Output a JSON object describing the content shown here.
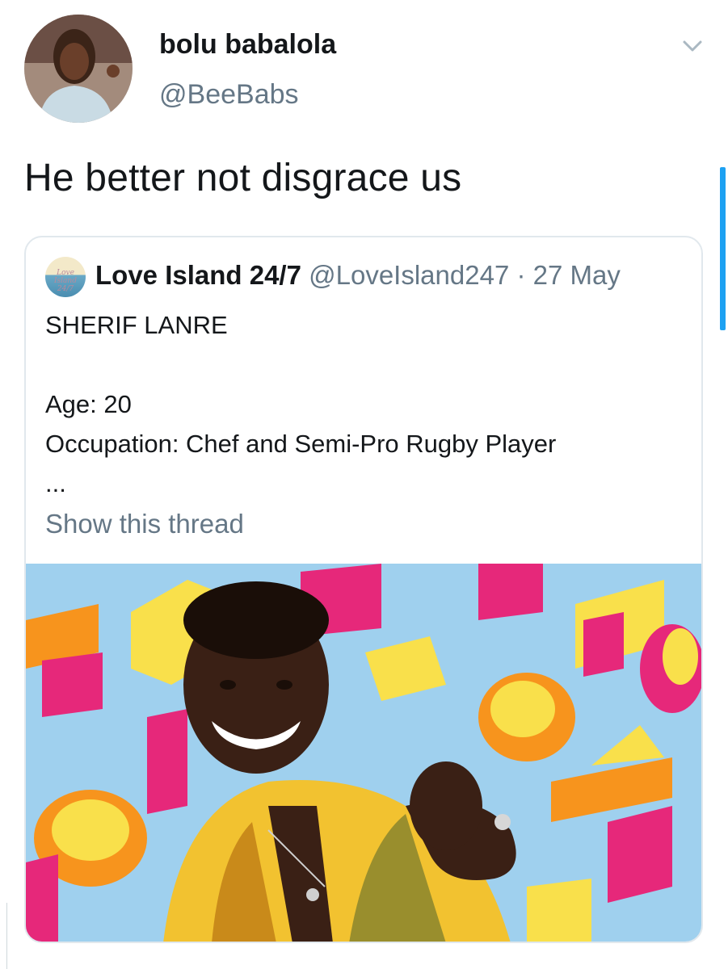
{
  "tweet": {
    "author": {
      "display_name": "bolu babalola",
      "handle": "@BeeBabs"
    },
    "text": "He better not disgrace us",
    "menu_icon": "chevron-down-icon"
  },
  "quoted_tweet": {
    "author": {
      "display_name": "Love Island 24/7",
      "handle": "@LoveIsland247",
      "avatar_text": "Love Island 24/7"
    },
    "separator": "·",
    "date": "27 May",
    "lines": [
      "SHERIF LANRE",
      "",
      "Age: 20",
      "Occupation: Chef and Semi-Pro Rugby Player",
      "..."
    ],
    "show_thread_label": "Show this thread"
  },
  "colors": {
    "accent": "#1da1f2",
    "secondary_text": "#657786",
    "border": "#e1e8ed"
  }
}
